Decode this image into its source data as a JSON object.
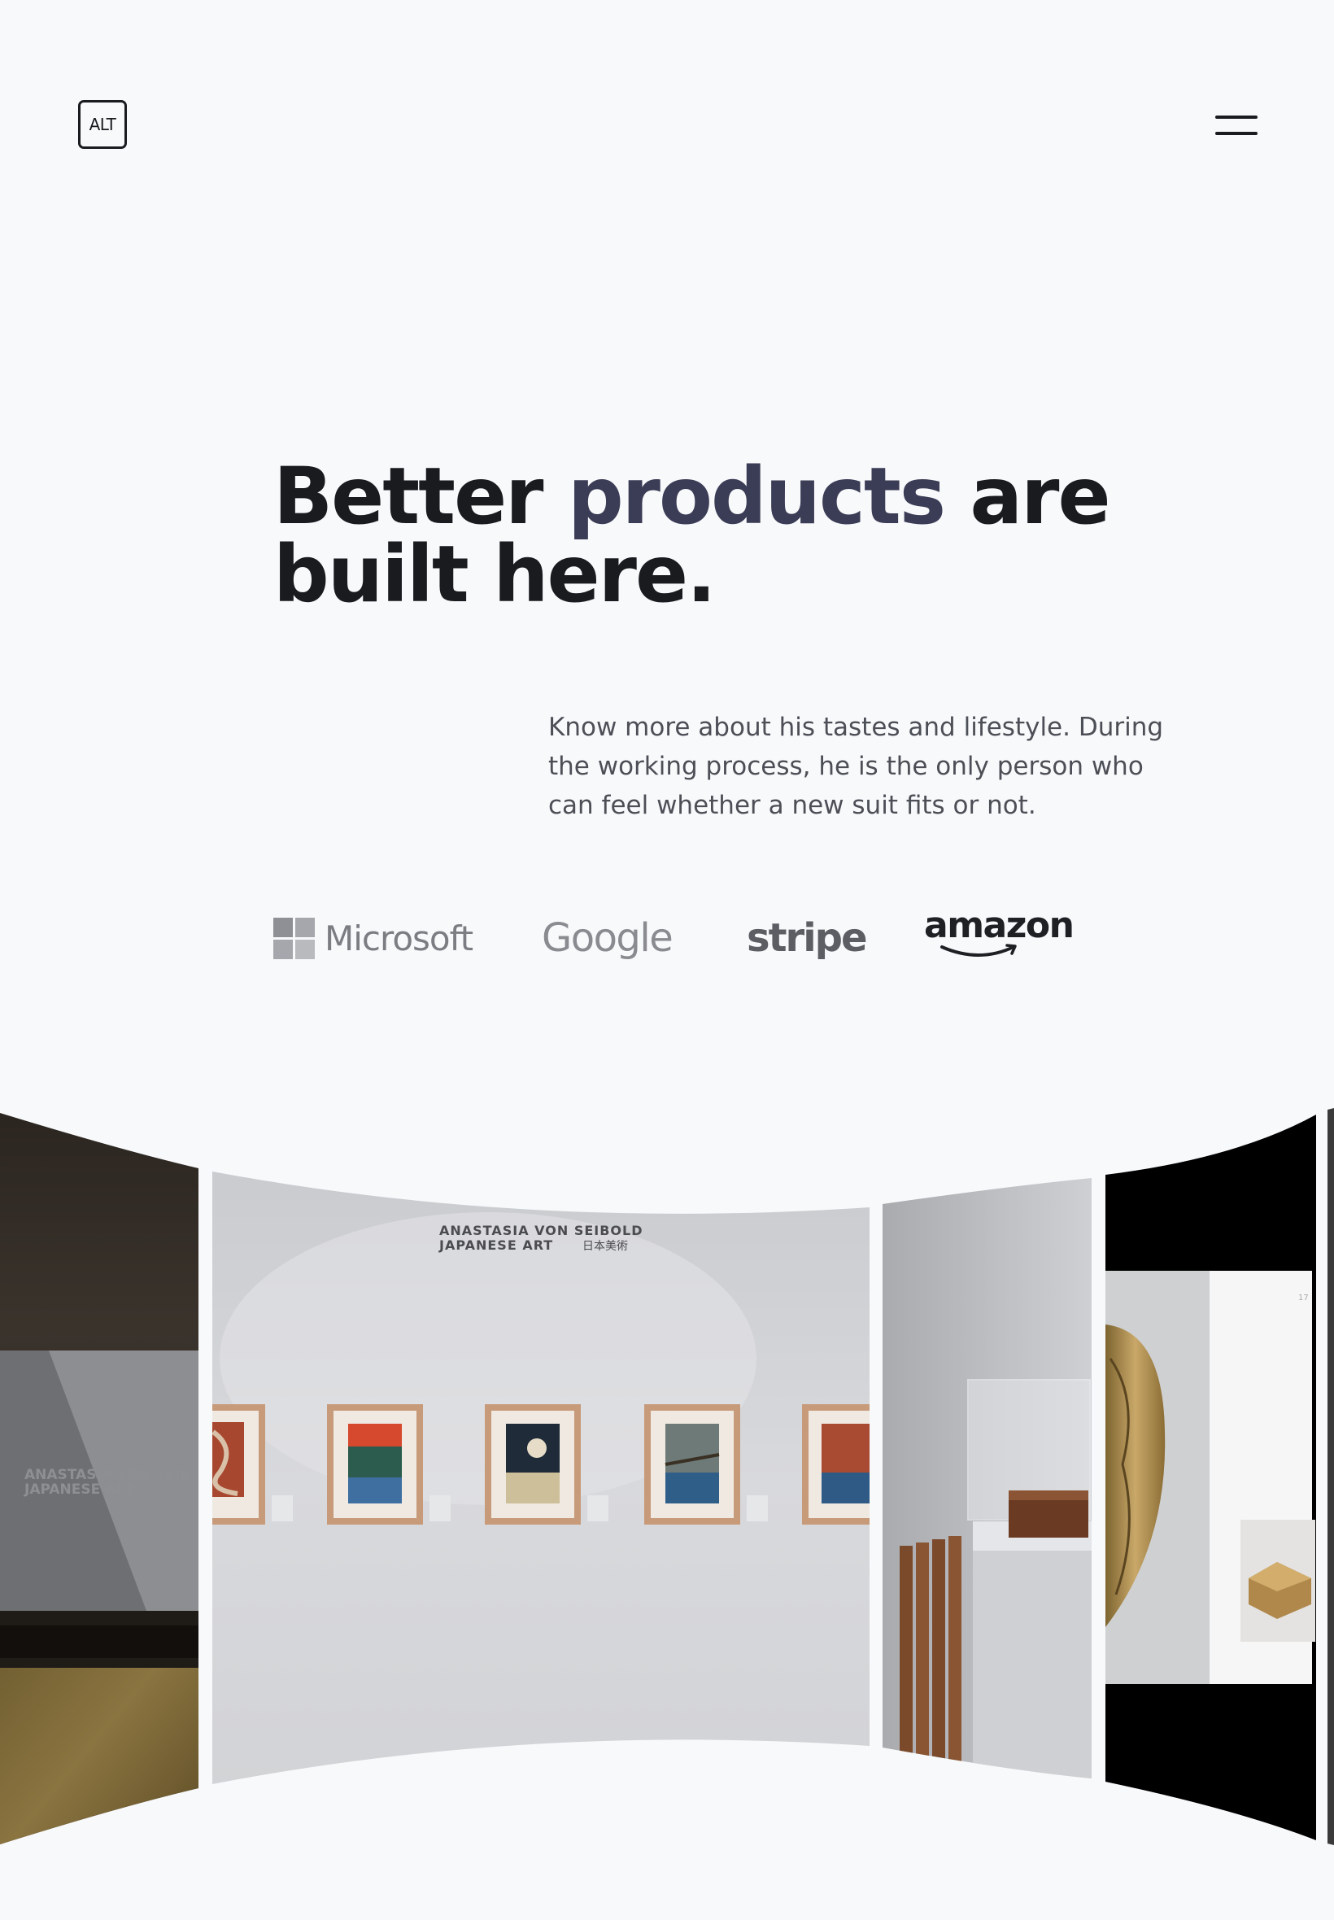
{
  "header": {
    "logo_text": "ALT",
    "menu_icon": "hamburger-icon"
  },
  "hero": {
    "title_part1": "Better ",
    "title_accent": "products",
    "title_part2": " are",
    "title_line2": "built here.",
    "description": "Know more about his tastes and lifestyle. During the working process, he is the only person who can feel whether a new suit fits or not.",
    "accent_color": "#3b3c55"
  },
  "brands": {
    "microsoft": "Microsoft",
    "google": "Google",
    "stripe": "stripe",
    "amazon": "amazon"
  },
  "gallery": {
    "panel1_caption_line1": "ANASTASIA VON SEIB",
    "panel1_caption_line2": "JAPANESE ART",
    "main_caption_line1": "ANASTASIA VON SEIBOLD",
    "main_caption_line2": "JAPANESE ART",
    "main_caption_jp": "日本美術",
    "page_num": "17"
  }
}
